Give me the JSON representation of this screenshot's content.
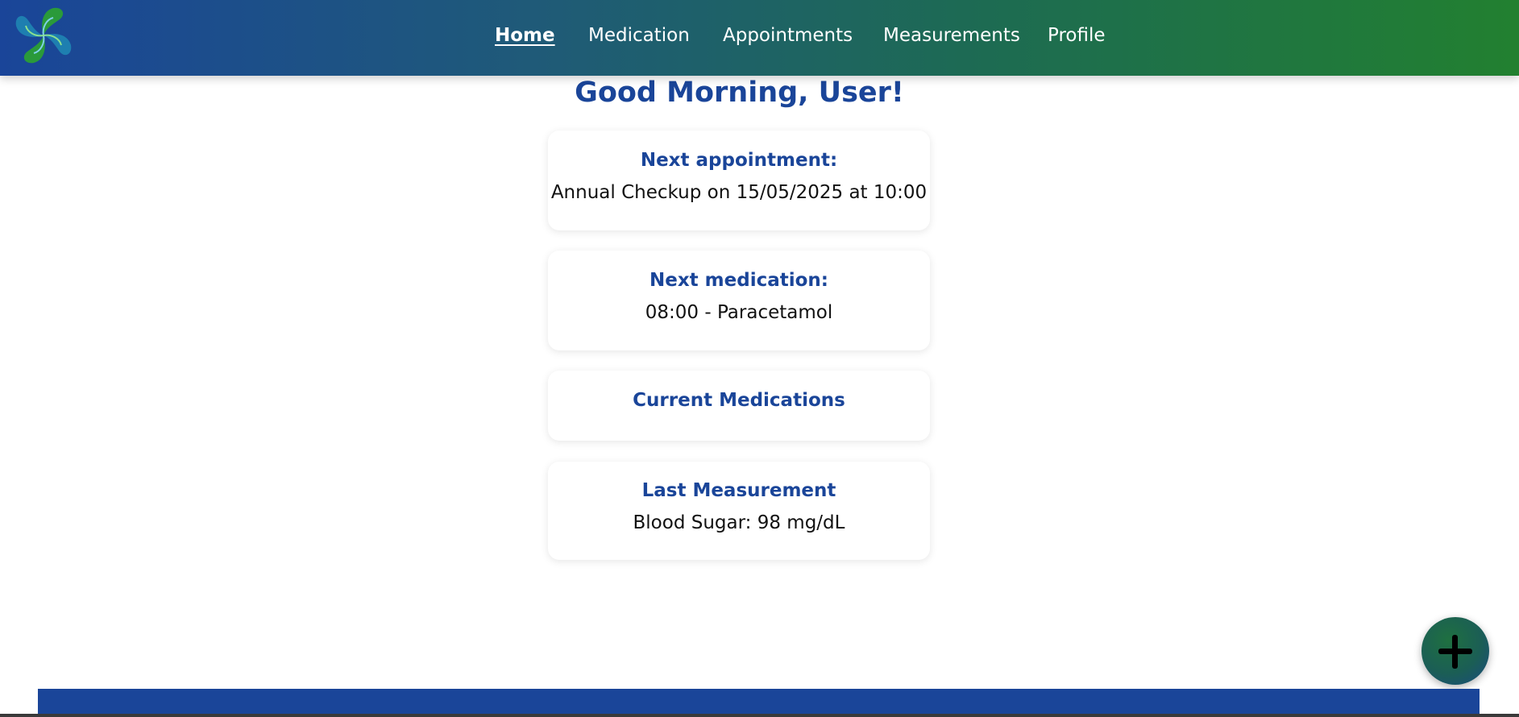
{
  "nav": {
    "logo_icon": "pinwheel-logo-icon",
    "links": [
      {
        "label": "Home",
        "active": true
      },
      {
        "label": "Medication",
        "active": false
      },
      {
        "label": "Appointments",
        "active": false
      },
      {
        "label": "Measurements",
        "active": false
      },
      {
        "label": "Profile",
        "active": false
      }
    ]
  },
  "greeting": "Good Morning, User!",
  "cards": {
    "appointment": {
      "title": "Next appointment:",
      "value": "Annual Checkup on 15/05/2025 at 10:00"
    },
    "medication": {
      "title": "Next medication:",
      "value": "08:00 - Paracetamol"
    },
    "current_medications": {
      "title": "Current Medications"
    },
    "measurement": {
      "title": "Last Measurement",
      "value": "Blood Sugar: 98 mg/dL"
    }
  },
  "fab": {
    "icon": "plus-icon"
  },
  "colors": {
    "primary_blue": "#1a4599",
    "accent_green": "#228030",
    "text_dark": "#111111"
  }
}
